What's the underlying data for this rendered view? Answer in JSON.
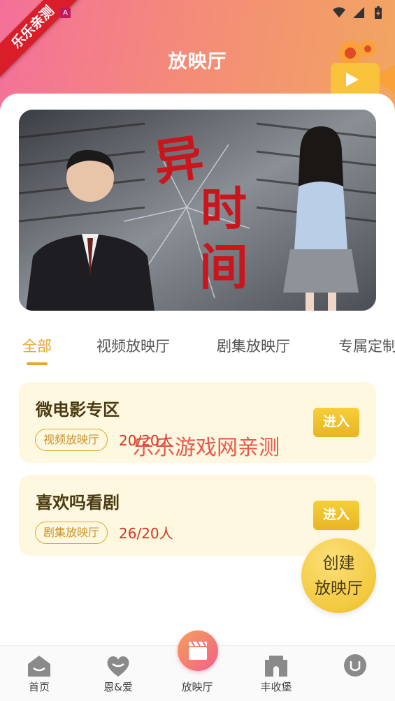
{
  "status": {
    "badge": "A"
  },
  "corner_ribbon": "乐乐亲测",
  "header": {
    "title": "放映厅"
  },
  "banner": {
    "title_art": "异时间"
  },
  "tabs": [
    {
      "label": "全部",
      "active": true
    },
    {
      "label": "视频放映厅",
      "active": false
    },
    {
      "label": "剧集放映厅",
      "active": false
    },
    {
      "label": "专属定制",
      "active": false
    }
  ],
  "cards": [
    {
      "title": "微电影专区",
      "tag": "视频放映厅",
      "count": "20/20人",
      "button": "进入"
    },
    {
      "title": "喜欢吗看剧",
      "tag": "剧集放映厅",
      "count": "26/20人",
      "button": "进入"
    }
  ],
  "watermark": "乐乐游戏网亲测",
  "create_button": {
    "line1": "创建",
    "line2": "放映厅"
  },
  "bottom_nav": [
    {
      "label": "首页",
      "icon": "home-icon"
    },
    {
      "label": "恩&爱",
      "icon": "heart-icon"
    },
    {
      "label": "放映厅",
      "icon": "clapperboard-icon"
    },
    {
      "label": "丰收堡",
      "icon": "castle-icon"
    },
    {
      "label": "",
      "icon": "profile-icon"
    }
  ],
  "colors": {
    "accent": "#e0a82e",
    "card_bg": "#fff8e0",
    "count_red": "#d5331f"
  }
}
